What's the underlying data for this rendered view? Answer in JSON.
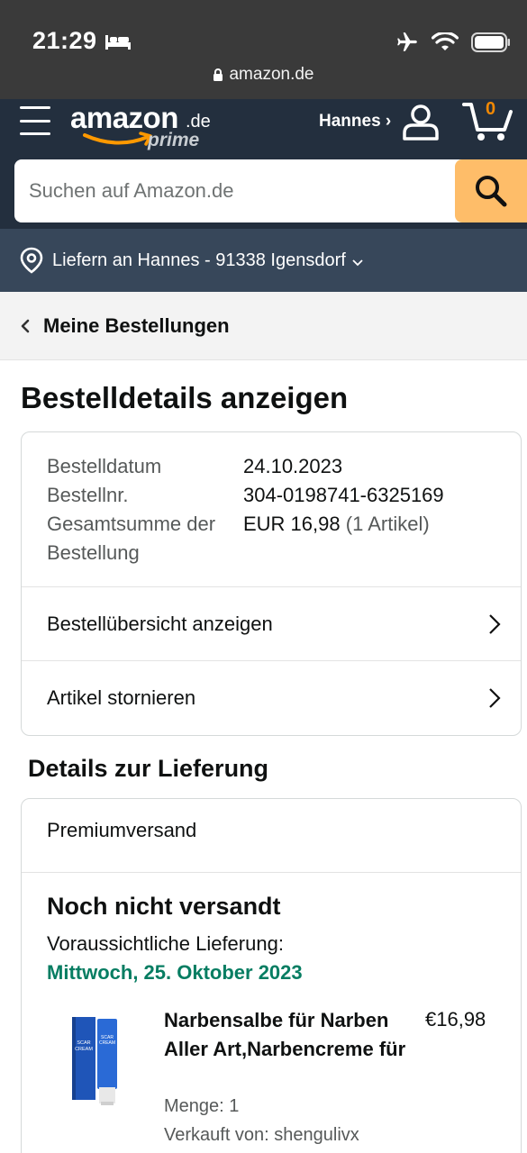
{
  "status_bar": {
    "time": "21:29",
    "url": "amazon.de",
    "icons": [
      "bed-icon",
      "airplane-icon",
      "wifi-icon",
      "battery-icon",
      "lock-icon"
    ]
  },
  "header": {
    "logo_word": "amazon",
    "logo_tld": ".de",
    "logo_prime": "prime",
    "account_label": "Hannes ›",
    "cart_count": "0"
  },
  "search": {
    "placeholder": "Suchen auf Amazon.de"
  },
  "delivery": {
    "label": "Liefern an Hannes - 91338 Igensdorf"
  },
  "breadcrumb": {
    "label": "Meine Bestellungen"
  },
  "page": {
    "title": "Bestelldetails anzeigen"
  },
  "order": {
    "date_label": "Bestelldatum",
    "date_value": "24.10.2023",
    "number_label": "Bestellnr.",
    "number_value": "304-0198741-6325169",
    "total_label": "Gesamtsumme der Bestellung",
    "total_value": "EUR 16,98",
    "total_items": "(1 Artikel)",
    "links": [
      {
        "label": "Bestellübersicht anzeigen"
      },
      {
        "label": "Artikel stornieren"
      }
    ]
  },
  "delivery_details": {
    "section_title": "Details zur Lieferung",
    "shipping_method": "Premiumversand",
    "status": "Noch nicht versandt",
    "eta_label": "Voraussichtliche Lieferung:",
    "eta_date": "Mittwoch, 25. Oktober 2023",
    "product": {
      "title": "Narbensalbe für Narben Aller Art,Narbencreme für",
      "price": "€16,98",
      "quantity": "Menge: 1",
      "seller": "Verkauft von: shengulivx",
      "image_text": "SCAR CREAM"
    }
  },
  "colors": {
    "nav_dark": "#232f3e",
    "nav_secondary": "#37475a",
    "search_button": "#febd69",
    "cart_accent": "#f08804",
    "delivery_green": "#067d62"
  }
}
